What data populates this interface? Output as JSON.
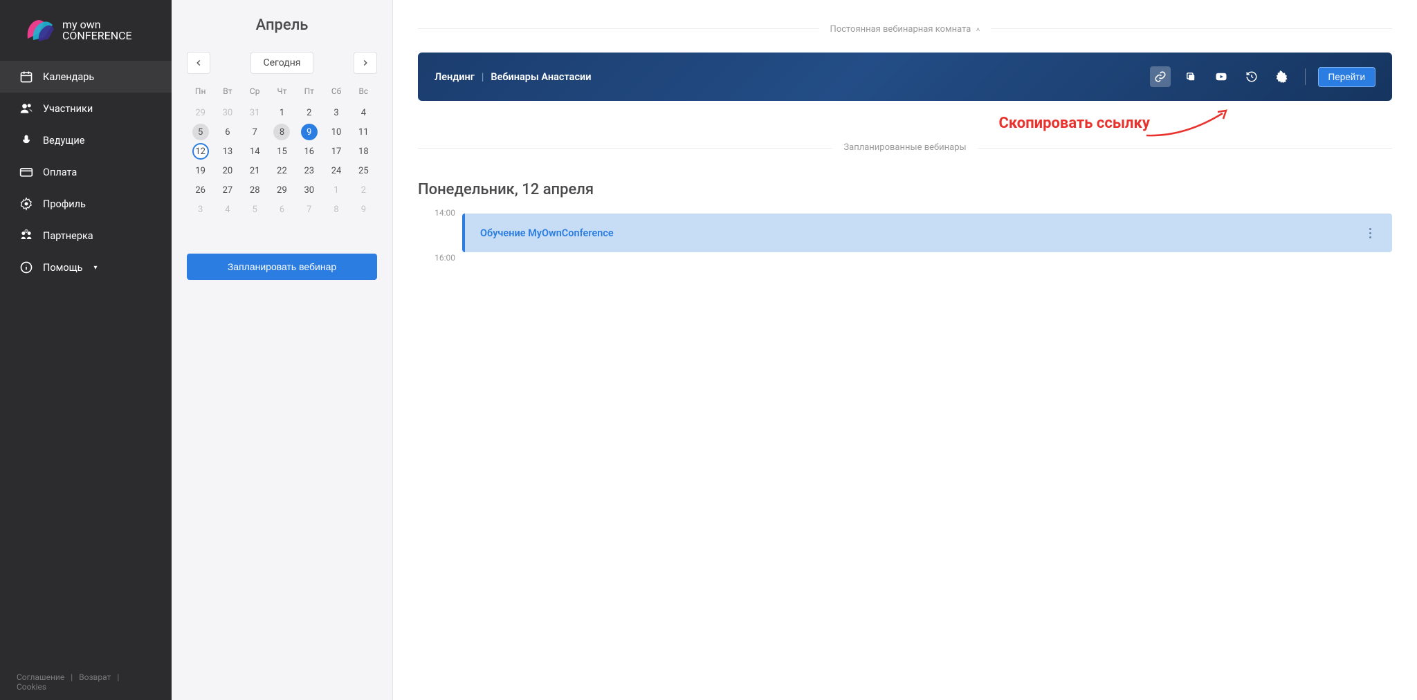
{
  "logo": {
    "top": "my own",
    "bottom": "CONFERENCE"
  },
  "nav": {
    "calendar": "Календарь",
    "participants": "Участники",
    "presenters": "Ведущие",
    "payment": "Оплата",
    "profile": "Профиль",
    "affiliate": "Партнерка",
    "help": "Помощь"
  },
  "footer": {
    "agreement": "Соглашение",
    "refund": "Возврат",
    "cookies": "Cookies"
  },
  "calendar": {
    "month": "Апрель",
    "today": "Сегодня",
    "weekdays": [
      "Пн",
      "Вт",
      "Ср",
      "Чт",
      "Пт",
      "Сб",
      "Вс"
    ],
    "rows": [
      [
        {
          "n": 29,
          "o": true
        },
        {
          "n": 30,
          "o": true
        },
        {
          "n": 31,
          "o": true
        },
        {
          "n": 1
        },
        {
          "n": 2
        },
        {
          "n": 3
        },
        {
          "n": 4
        }
      ],
      [
        {
          "n": 5,
          "g": true
        },
        {
          "n": 6
        },
        {
          "n": 7
        },
        {
          "n": 8,
          "g": true
        },
        {
          "n": 9,
          "s": true
        },
        {
          "n": 10
        },
        {
          "n": 11
        }
      ],
      [
        {
          "n": 12,
          "r": true
        },
        {
          "n": 13
        },
        {
          "n": 14
        },
        {
          "n": 15
        },
        {
          "n": 16
        },
        {
          "n": 17
        },
        {
          "n": 18
        }
      ],
      [
        {
          "n": 19
        },
        {
          "n": 20
        },
        {
          "n": 21
        },
        {
          "n": 22
        },
        {
          "n": 23
        },
        {
          "n": 24
        },
        {
          "n": 25
        }
      ],
      [
        {
          "n": 26
        },
        {
          "n": 27
        },
        {
          "n": 28
        },
        {
          "n": 29
        },
        {
          "n": 30
        },
        {
          "n": 1,
          "o": true
        },
        {
          "n": 2,
          "o": true
        }
      ],
      [
        {
          "n": 3,
          "o": true
        },
        {
          "n": 4,
          "o": true
        },
        {
          "n": 5,
          "o": true
        },
        {
          "n": 6,
          "o": true
        },
        {
          "n": 7,
          "o": true
        },
        {
          "n": 8,
          "o": true
        },
        {
          "n": 9,
          "o": true
        }
      ]
    ],
    "plan_button": "Запланировать вебинар"
  },
  "main": {
    "room_toggle": "Постоянная вебинарная комната",
    "landing": "Лендинг",
    "room_name": "Вебинары Анастасии",
    "go": "Перейти",
    "annotation": "Скопировать ссылку",
    "scheduled_label": "Запланированные вебинары",
    "day_title": "Понедельник, 12 апреля",
    "times": [
      "14:00",
      "16:00"
    ],
    "event_title": "Обучение MyOwnConference"
  }
}
